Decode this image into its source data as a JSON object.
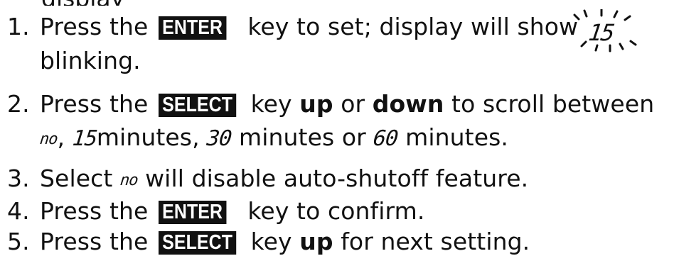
{
  "steps": [
    {
      "number": "1.",
      "line1_a": "Press the",
      "key": "ENTER",
      "line1_b": "key to set; display will show",
      "line2": "blinking."
    },
    {
      "number": "2.",
      "line1_a": "Press the",
      "key": "SELECT",
      "line1_b": "key",
      "bold1": "up",
      "line1_c": "or",
      "bold2": "down",
      "line1_d": "to scroll between",
      "line2_a": ",",
      "line2_b": "minutes,",
      "line2_c": "minutes or",
      "line2_d": "minutes."
    },
    {
      "number": "3.",
      "text_a": "Select",
      "text_b": "will disable auto-shutoff feature."
    },
    {
      "number": "4.",
      "text_a": "Press the",
      "key": "ENTER",
      "text_b": "key to confirm."
    },
    {
      "number": "5.",
      "text_a": "Press the",
      "key": "SELECT",
      "text_b": "key",
      "bold": "up",
      "text_c": "for next setting."
    }
  ],
  "display_values": {
    "no": "no",
    "fifteen": "15",
    "thirty": "30",
    "sixty": "60"
  }
}
